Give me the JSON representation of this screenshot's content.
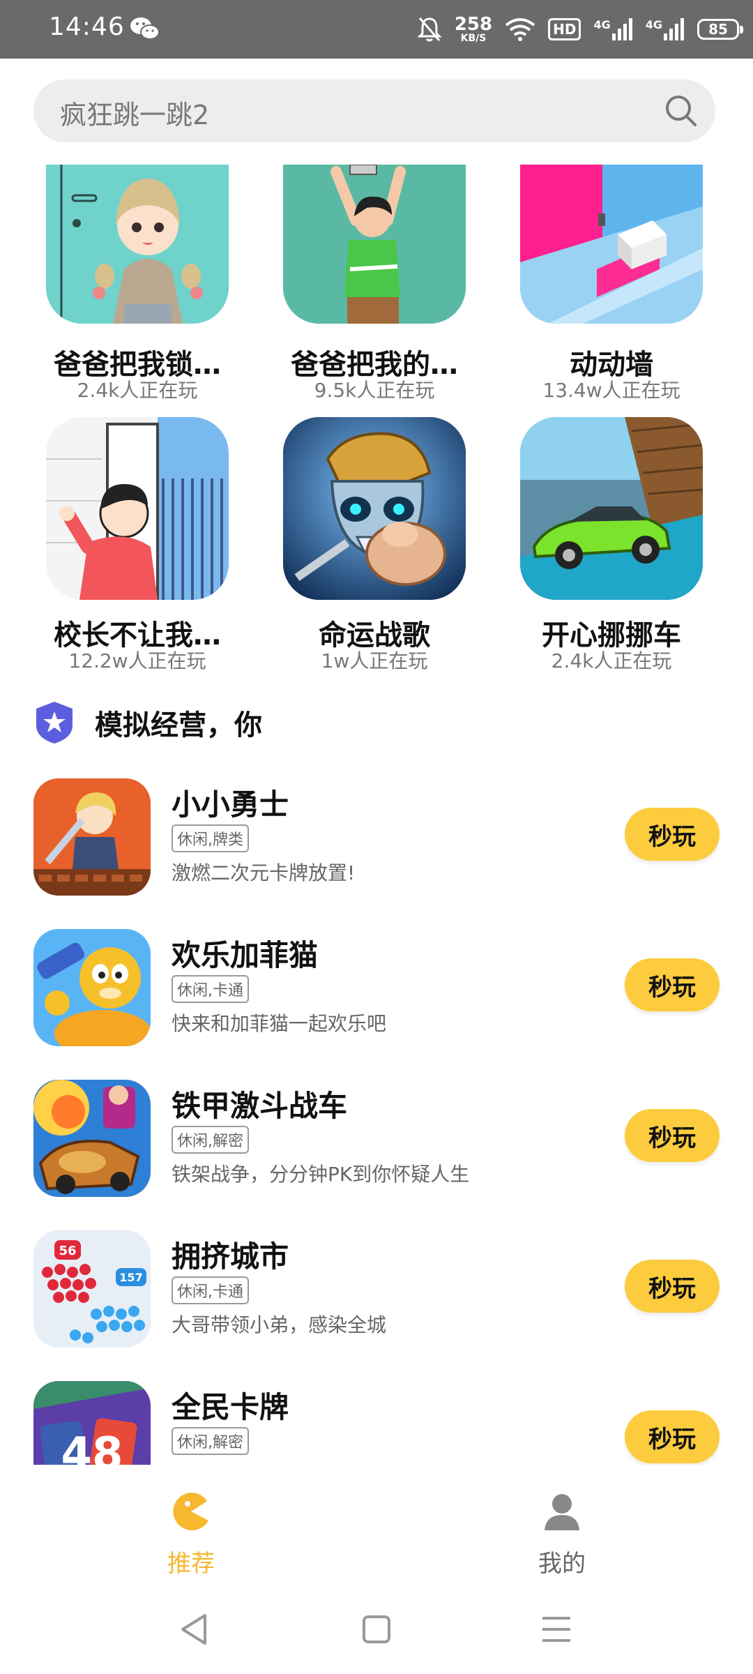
{
  "status_bar": {
    "time": "14:46",
    "net_speed_value": "258",
    "net_speed_unit": "KB/S",
    "hd_label": "HD",
    "net1": "4G",
    "net2": "4G",
    "battery": "85"
  },
  "search": {
    "placeholder": "疯狂跳一跳2"
  },
  "games": [
    {
      "name": "爸爸把我锁…",
      "players": "2.4k人正在玩"
    },
    {
      "name": "爸爸把我的…",
      "players": "9.5k人正在玩"
    },
    {
      "name": "动动墙",
      "players": "13.4w人正在玩"
    },
    {
      "name": "校长不让我…",
      "players": "12.2w人正在玩"
    },
    {
      "name": "命运战歌",
      "players": "1w人正在玩"
    },
    {
      "name": "开心挪挪车",
      "players": "2.4k人正在玩"
    }
  ],
  "section": {
    "title": "模拟经营，你"
  },
  "list": [
    {
      "title": "小小勇士",
      "tag": "休闲,牌类",
      "desc": "激燃二次元卡牌放置!",
      "button": "秒玩"
    },
    {
      "title": "欢乐加菲猫",
      "tag": "休闲,卡通",
      "desc": "快来和加菲猫一起欢乐吧",
      "button": "秒玩"
    },
    {
      "title": "铁甲激斗战车",
      "tag": "休闲,解密",
      "desc": "铁架战争，分分钟PK到你怀疑人生",
      "button": "秒玩"
    },
    {
      "title": "拥挤城市",
      "tag": "休闲,卡通",
      "desc": "大哥带领小弟，感染全城",
      "button": "秒玩"
    },
    {
      "title": "全民卡牌",
      "tag": "休闲,解密",
      "desc": "",
      "button": "秒玩"
    }
  ],
  "list_art_text": {
    "crowd_a": "56",
    "crowd_b": "157",
    "card": "48"
  },
  "bottom_nav": {
    "recommend": "推荐",
    "mine": "我的"
  },
  "colors": {
    "accent": "#fccb3e",
    "active_tab": "#f5b82e",
    "inactive_tab": "#666666"
  }
}
